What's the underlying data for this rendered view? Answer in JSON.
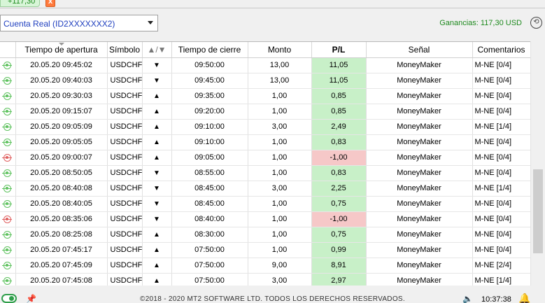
{
  "top": {
    "badge": "+117,30",
    "close_glyph": "x"
  },
  "account": {
    "selected": "Cuenta Real (ID2XXXXXXX2)"
  },
  "earnings": {
    "label": "Ganancias:  117,30 USD"
  },
  "table": {
    "headers": [
      "",
      "Tiempo de apertura",
      "Símbolo",
      "▲/▼",
      "Tiempo de cierre",
      "Monto",
      "P/L",
      "Señal",
      "Comentarios"
    ],
    "rows": [
      {
        "status": "win",
        "open": "20.05.20 09:45:02",
        "symbol": "USDCHF",
        "dir": "▼",
        "close": "09:50:00",
        "amount": "13,00",
        "pl": "11,05",
        "signal": "MoneyMaker",
        "comment": "M-NE [0/4]"
      },
      {
        "status": "win",
        "open": "20.05.20 09:40:03",
        "symbol": "USDCHF",
        "dir": "▼",
        "close": "09:45:00",
        "amount": "13,00",
        "pl": "11,05",
        "signal": "MoneyMaker",
        "comment": "M-NE [0/4]"
      },
      {
        "status": "win",
        "open": "20.05.20 09:30:03",
        "symbol": "USDCHF",
        "dir": "▲",
        "close": "09:35:00",
        "amount": "1,00",
        "pl": "0,85",
        "signal": "MoneyMaker",
        "comment": "M-NE [0/4]"
      },
      {
        "status": "win",
        "open": "20.05.20 09:15:07",
        "symbol": "USDCHF",
        "dir": "▲",
        "close": "09:20:00",
        "amount": "1,00",
        "pl": "0,85",
        "signal": "MoneyMaker",
        "comment": "M-NE [0/4]"
      },
      {
        "status": "win",
        "open": "20.05.20 09:05:09",
        "symbol": "USDCHF",
        "dir": "▲",
        "close": "09:10:00",
        "amount": "3,00",
        "pl": "2,49",
        "signal": "MoneyMaker",
        "comment": "M-NE [1/4]"
      },
      {
        "status": "win",
        "open": "20.05.20 09:05:05",
        "symbol": "USDCHF",
        "dir": "▲",
        "close": "09:10:00",
        "amount": "1,00",
        "pl": "0,83",
        "signal": "MoneyMaker",
        "comment": "M-NE [0/4]"
      },
      {
        "status": "loss",
        "open": "20.05.20 09:00:07",
        "symbol": "USDCHF",
        "dir": "▲",
        "close": "09:05:00",
        "amount": "1,00",
        "pl": "-1,00",
        "signal": "MoneyMaker",
        "comment": "M-NE [0/4]"
      },
      {
        "status": "win",
        "open": "20.05.20 08:50:05",
        "symbol": "USDCHF",
        "dir": "▼",
        "close": "08:55:00",
        "amount": "1,00",
        "pl": "0,83",
        "signal": "MoneyMaker",
        "comment": "M-NE [0/4]"
      },
      {
        "status": "win",
        "open": "20.05.20 08:40:08",
        "symbol": "USDCHF",
        "dir": "▼",
        "close": "08:45:00",
        "amount": "3,00",
        "pl": "2,25",
        "signal": "MoneyMaker",
        "comment": "M-NE [1/4]"
      },
      {
        "status": "win",
        "open": "20.05.20 08:40:05",
        "symbol": "USDCHF",
        "dir": "▼",
        "close": "08:45:00",
        "amount": "1,00",
        "pl": "0,75",
        "signal": "MoneyMaker",
        "comment": "M-NE [0/4]"
      },
      {
        "status": "loss",
        "open": "20.05.20 08:35:06",
        "symbol": "USDCHF",
        "dir": "▼",
        "close": "08:40:00",
        "amount": "1,00",
        "pl": "-1,00",
        "signal": "MoneyMaker",
        "comment": "M-NE [0/4]"
      },
      {
        "status": "win",
        "open": "20.05.20 08:25:08",
        "symbol": "USDCHF",
        "dir": "▲",
        "close": "08:30:00",
        "amount": "1,00",
        "pl": "0,75",
        "signal": "MoneyMaker",
        "comment": "M-NE [0/4]"
      },
      {
        "status": "win",
        "open": "20.05.20 07:45:17",
        "symbol": "USDCHF",
        "dir": "▲",
        "close": "07:50:00",
        "amount": "1,00",
        "pl": "0,99",
        "signal": "MoneyMaker",
        "comment": "M-NE [0/4]"
      },
      {
        "status": "win",
        "open": "20.05.20 07:45:09",
        "symbol": "USDCHF",
        "dir": "▲",
        "close": "07:50:00",
        "amount": "9,00",
        "pl": "8,91",
        "signal": "MoneyMaker",
        "comment": "M-NE [2/4]"
      },
      {
        "status": "win",
        "open": "20.05.20 07:45:08",
        "symbol": "USDCHF",
        "dir": "▲",
        "close": "07:50:00",
        "amount": "3,00",
        "pl": "2,97",
        "signal": "MoneyMaker",
        "comment": "M-NE [1/4]"
      }
    ]
  },
  "footer": {
    "copyright": "©2018 - 2020 MT2 SOFTWARE LTD. TODOS LOS DERECHOS RESERVADOS.",
    "time": "10:37:38"
  },
  "icons": {
    "close": "close-icon",
    "dropdown": "chevron-down-icon",
    "settings": "settings-icon",
    "row_status_win": "target-icon",
    "row_status_loss": "target-icon",
    "pin": "pin-icon",
    "volume": "volume-icon",
    "bell": "bell-icon"
  },
  "colors": {
    "positive_bg": "#c8f0c8",
    "negative_bg": "#f6c8c8",
    "win_icon": "#5ec25e",
    "loss_icon": "#e06060",
    "earnings": "#1e8a1e",
    "account_text": "#1f3fbf"
  }
}
